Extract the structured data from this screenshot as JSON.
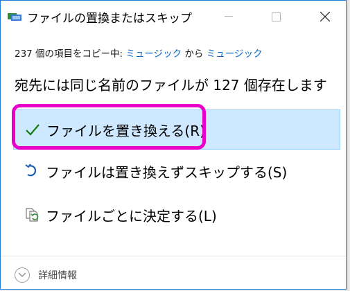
{
  "window": {
    "title": "ファイルの置換またはスキップ",
    "accent": "#1e7dd6"
  },
  "copy_status": {
    "prefix": "237 個の項目をコピー中: ",
    "source": "ミュージック",
    "middle": " から ",
    "destination": "ミュージック"
  },
  "heading": "宛先には同じ名前のファイルが 127 個存在します",
  "options": [
    {
      "label": "ファイルを置き換える(R)",
      "icon": "checkmark-icon",
      "selected": true
    },
    {
      "label": "ファイルは置き換えずスキップする(S)",
      "icon": "skip-arrow-icon",
      "selected": false
    },
    {
      "label": "ファイルごとに決定する(L)",
      "icon": "compare-files-icon",
      "selected": false
    }
  ],
  "footer": {
    "details_label": "詳細情報",
    "icon": "chevron-down-icon"
  },
  "colors": {
    "selected_bg": "#cde8ff",
    "link": "#0066cc",
    "annotation": "#e900c8"
  }
}
